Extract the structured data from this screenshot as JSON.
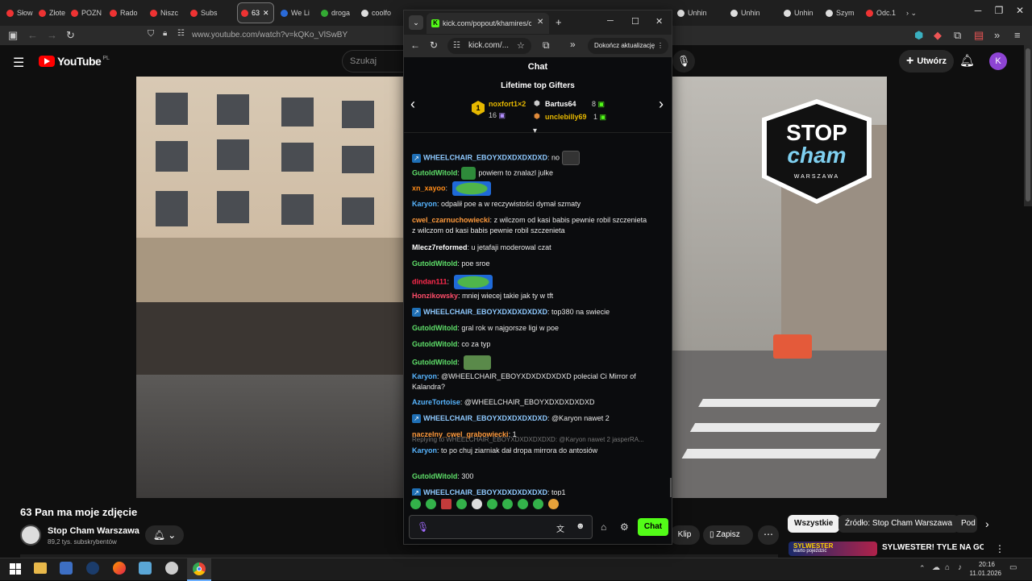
{
  "browser_tabs": [
    {
      "label": "Słow",
      "color": "#e33"
    },
    {
      "label": "Złote",
      "color": "#e33"
    },
    {
      "label": "POZN",
      "color": "#e33"
    },
    {
      "label": "Rado",
      "color": "#e33"
    },
    {
      "label": "Niszc",
      "color": "#e33"
    },
    {
      "label": "Subs",
      "color": "#e33"
    },
    {
      "label": "63",
      "color": "#e33",
      "active": true
    },
    {
      "label": "We Li",
      "color": "#2a6ad8"
    },
    {
      "label": "droga",
      "color": "#3a3"
    },
    {
      "label": "coolfo",
      "color": "#ddd"
    }
  ],
  "browser_tabs_right": [
    {
      "label": "Unhin",
      "color": "#ddd"
    },
    {
      "label": "Unhin",
      "color": "#ddd"
    },
    {
      "label": "Unhin",
      "color": "#ddd"
    },
    {
      "label": "Szym",
      "color": "#ddd"
    },
    {
      "label": "Odc.1",
      "color": "#e33"
    }
  ],
  "address": "www.youtube.com/watch?v=kQKo_VlSwBY",
  "youtube": {
    "logo": "YouTube",
    "region": "PL",
    "search_placeholder": "Szukaj",
    "create_label": "Utwórz",
    "avatar_letter": "K",
    "video_title": "63 Pan ma moje zdjęcie",
    "channel_name": "Stop Cham Warszawa",
    "subscribers": "89,2 tys. subskrybentów",
    "clip_label": "Klip",
    "save_label": "Zapisz",
    "chips": [
      "Wszystkie",
      "Źródło: Stop Cham Warszawa",
      "Pod"
    ],
    "recommended_title": "SYLWESTER! TYLE NA GODZINĘ!!",
    "thumb_text_1": "SYLWESTER",
    "thumb_text_2": "warto pojeździć"
  },
  "watermark": {
    "top": "STOP",
    "mid": "cham",
    "bottom": "WARSZAWA"
  },
  "popup": {
    "tab_title": "kick.com/popout/khamires/chat",
    "url": "kick.com/...",
    "update_button": "Dokończ aktualizację",
    "chat_title": "Chat",
    "gifters_title": "Lifetime top Gifters",
    "gifters": [
      {
        "rank": "1",
        "name": "noxfort1×2",
        "count": "16",
        "color": "#e6b800"
      },
      {
        "rank": "",
        "name": "Bartus64",
        "count": "8",
        "color": "#ffffff"
      },
      {
        "rank": "",
        "name": "unclebilly69",
        "count": "1",
        "color": "#e6b800"
      }
    ],
    "messages": [
      {
        "user": "WHEELCHAIR_EBOYXDXDXDXDXD",
        "color": "#8ec9ff",
        "badge": true,
        "text": "no",
        "emote": "dark"
      },
      {
        "user": "GutoldWitold",
        "color": "#5fe06a",
        "pre_emote": "frog",
        "text": "powiem to znalazl julke"
      },
      {
        "user": "xn_xayoo",
        "color": "#ff8c1a",
        "text": "",
        "emote": "pepe-wide"
      },
      {
        "user": "Karyon",
        "color": "#57b5ff",
        "text": "odpalił poe a w reczywistości dymał szmaty"
      },
      {
        "user": "cwel_czarnuchowiecki",
        "color": "#ff9a3c",
        "text": "z wilczom od kasi babis pewnie robil szczenieta",
        "line2": "z wilczom od kasi babis pewnie robil szczenieta"
      },
      {
        "user": "Mlecz7reformed",
        "color": "#ffffff",
        "text": "u jetafaji moderowal czat"
      },
      {
        "user": "GutoldWitold",
        "color": "#5fe06a",
        "text": "poe sroe"
      },
      {
        "user": "dindan111",
        "color": "#ff2a4d",
        "text": "",
        "emote": "pepe-wide"
      },
      {
        "user": "Honzikowsky",
        "color": "#ff4d6a",
        "text": "mniej wiecej takie jak ty w tft"
      },
      {
        "user": "WHEELCHAIR_EBOYXDXDXDXDXD",
        "color": "#8ec9ff",
        "badge": true,
        "text": "top380 na swiecie"
      },
      {
        "user": "GutoldWitold",
        "color": "#5fe06a",
        "text": "gral rok w najgorsze ligi w poe"
      },
      {
        "user": "GutoldWitold",
        "color": "#5fe06a",
        "text": "co za typ"
      },
      {
        "user": "GutoldWitold",
        "color": "#5fe06a",
        "text": "",
        "emote": "frog-big"
      },
      {
        "user": "Karyon",
        "color": "#57b5ff",
        "text": "@WHEELCHAIR_EBOYXDXDXDXDXD polecial Ci Mirror of",
        "line2": "Kalandra?"
      },
      {
        "user": "AzureTortoise",
        "color": "#57b5ff",
        "text": "@WHEELCHAIR_EBOYXDXDXDXDXD"
      },
      {
        "user": "WHEELCHAIR_EBOYXDXDXDXDXD",
        "color": "#8ec9ff",
        "badge": true,
        "text": "@Karyon nawet 2"
      },
      {
        "user": "naczelny_cwel_grabowiecki",
        "color": "#ff9a3c",
        "text": "1"
      },
      {
        "reply": "Replying to WHEELCHAIR_EBOYXDXDXDXDXD: @Karyon nawet 2 jasperRA...",
        "user": "Karyon",
        "color": "#57b5ff",
        "text": "to po chuj ziarniak dał dropa mirrora do antosiów"
      },
      {
        "user": "GutoldWitold",
        "color": "#5fe06a",
        "text": "300"
      },
      {
        "user": "WHEELCHAIR_EBOYXDXDXDXDXD",
        "color": "#8ec9ff",
        "badge": true,
        "text": "top1"
      }
    ],
    "send_label": "Chat"
  },
  "taskbar": {
    "time": "20:16",
    "date": "11.01.2026"
  }
}
